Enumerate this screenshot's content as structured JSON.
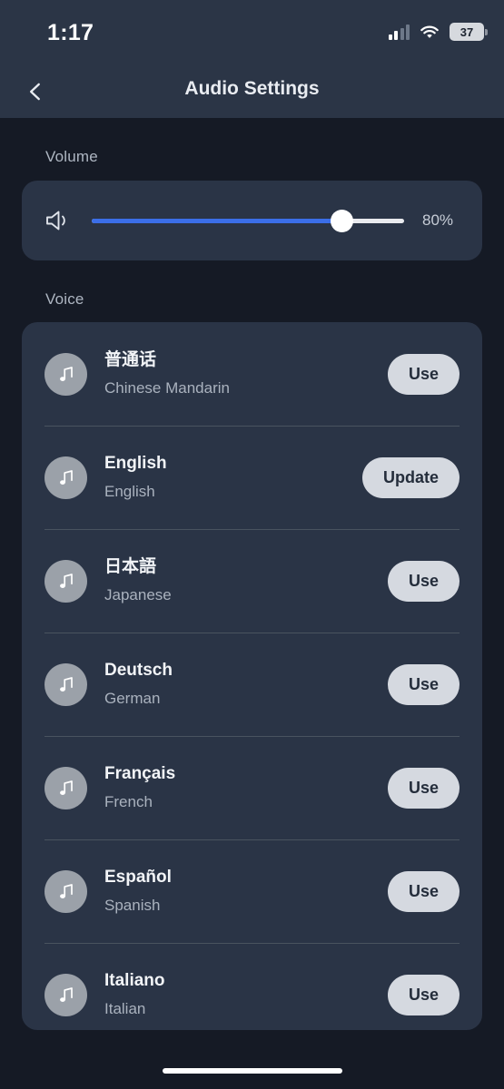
{
  "status_bar": {
    "time": "1:17",
    "battery_level": "37",
    "signal_icon": "cellular-signal-icon",
    "wifi_icon": "wifi-icon",
    "battery_icon": "battery-icon"
  },
  "nav": {
    "title": "Audio Settings",
    "back_icon": "chevron-left-icon"
  },
  "volume": {
    "section_label": "Volume",
    "speaker_icon": "speaker-icon",
    "value_label": "80%",
    "percent": 80,
    "fill_color": "#3b6ee8",
    "track_color": "#e9eaee",
    "thumb_color": "#ffffff"
  },
  "voice": {
    "section_label": "Voice",
    "rows": [
      {
        "name": "普通话",
        "subtitle": "Chinese Mandarin",
        "action": "Use",
        "icon": "music-note-icon"
      },
      {
        "name": "English",
        "subtitle": "English",
        "action": "Update",
        "icon": "music-note-icon"
      },
      {
        "name": "日本語",
        "subtitle": "Japanese",
        "action": "Use",
        "icon": "music-note-icon"
      },
      {
        "name": "Deutsch",
        "subtitle": "German",
        "action": "Use",
        "icon": "music-note-icon"
      },
      {
        "name": "Français",
        "subtitle": "French",
        "action": "Use",
        "icon": "music-note-icon"
      },
      {
        "name": "Español",
        "subtitle": "Spanish",
        "action": "Use",
        "icon": "music-note-icon"
      },
      {
        "name": "Italiano",
        "subtitle": "Italian",
        "action": "Use",
        "icon": "music-note-icon"
      }
    ]
  },
  "home_indicator": "home-indicator"
}
